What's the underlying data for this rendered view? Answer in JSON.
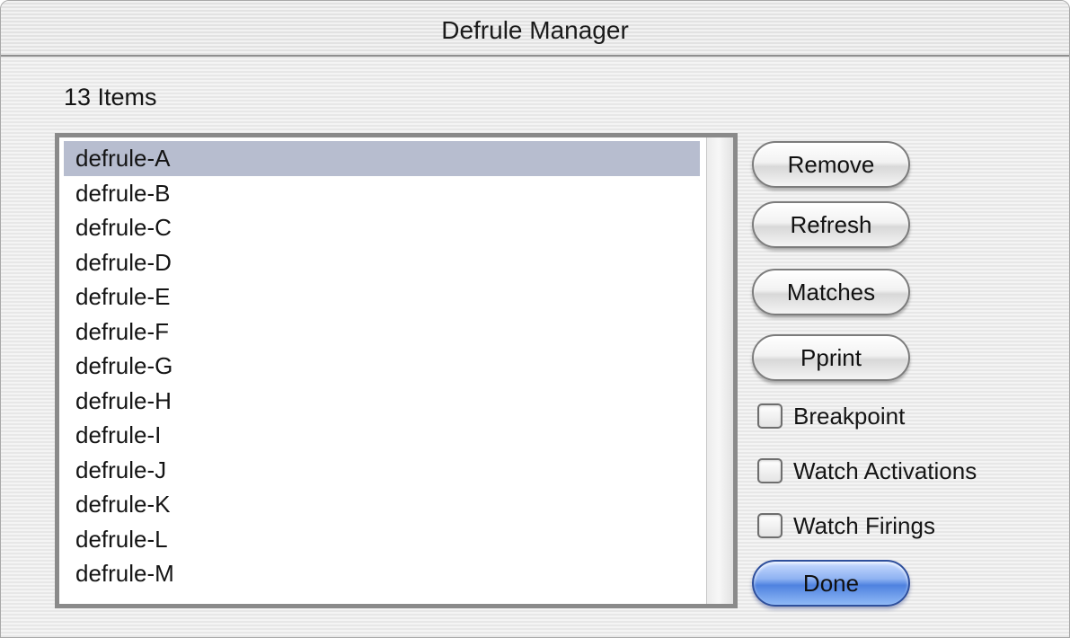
{
  "window": {
    "title": "Defrule Manager"
  },
  "item_count_label": "13 Items",
  "rules": [
    {
      "label": "defrule-A",
      "selected": true
    },
    {
      "label": "defrule-B",
      "selected": false
    },
    {
      "label": "defrule-C",
      "selected": false
    },
    {
      "label": "defrule-D",
      "selected": false
    },
    {
      "label": "defrule-E",
      "selected": false
    },
    {
      "label": "defrule-F",
      "selected": false
    },
    {
      "label": "defrule-G",
      "selected": false
    },
    {
      "label": "defrule-H",
      "selected": false
    },
    {
      "label": "defrule-I",
      "selected": false
    },
    {
      "label": "defrule-J",
      "selected": false
    },
    {
      "label": "defrule-K",
      "selected": false
    },
    {
      "label": "defrule-L",
      "selected": false
    },
    {
      "label": "defrule-M",
      "selected": false
    }
  ],
  "buttons": {
    "remove": "Remove",
    "refresh": "Refresh",
    "matches": "Matches",
    "pprint": "Pprint",
    "done": "Done"
  },
  "checkboxes": {
    "breakpoint": {
      "label": "Breakpoint",
      "checked": false
    },
    "watch_activations": {
      "label": "Watch Activations",
      "checked": false
    },
    "watch_firings": {
      "label": "Watch Firings",
      "checked": false
    }
  },
  "colors": {
    "selection": "#b7bdcf",
    "default_button": "#4f82e0"
  }
}
